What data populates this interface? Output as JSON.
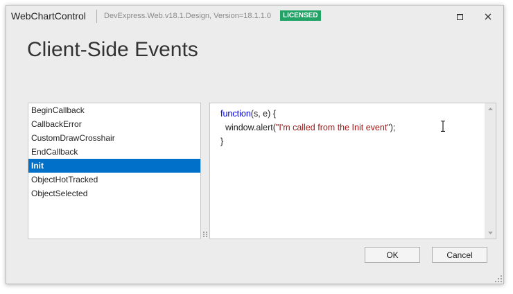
{
  "window": {
    "title": "WebChartControl",
    "version": "DevExpress.Web.v18.1.Design, Version=18.1.1.0",
    "badge": "LICENSED",
    "maximize_icon": "maximize-icon",
    "close_icon": "close-icon"
  },
  "page_title": "Client-Side Events",
  "events": [
    {
      "label": "BeginCallback",
      "selected": false
    },
    {
      "label": "CallbackError",
      "selected": false
    },
    {
      "label": "CustomDrawCrosshair",
      "selected": false
    },
    {
      "label": "EndCallback",
      "selected": false
    },
    {
      "label": "Init",
      "selected": true
    },
    {
      "label": "ObjectHotTracked",
      "selected": false
    },
    {
      "label": "ObjectSelected",
      "selected": false
    }
  ],
  "code": {
    "line1_keyword": "function",
    "line1_rest": "(s, e) {",
    "line2_call": "  window.alert(",
    "line2_string": "\"I'm called from the Init event\"",
    "line2_end": ");",
    "line3": "}"
  },
  "buttons": {
    "ok": "OK",
    "cancel": "Cancel"
  },
  "colors": {
    "selection": "#0070c8",
    "badge": "#21a366",
    "keyword": "#0000e0",
    "string": "#a31515"
  }
}
